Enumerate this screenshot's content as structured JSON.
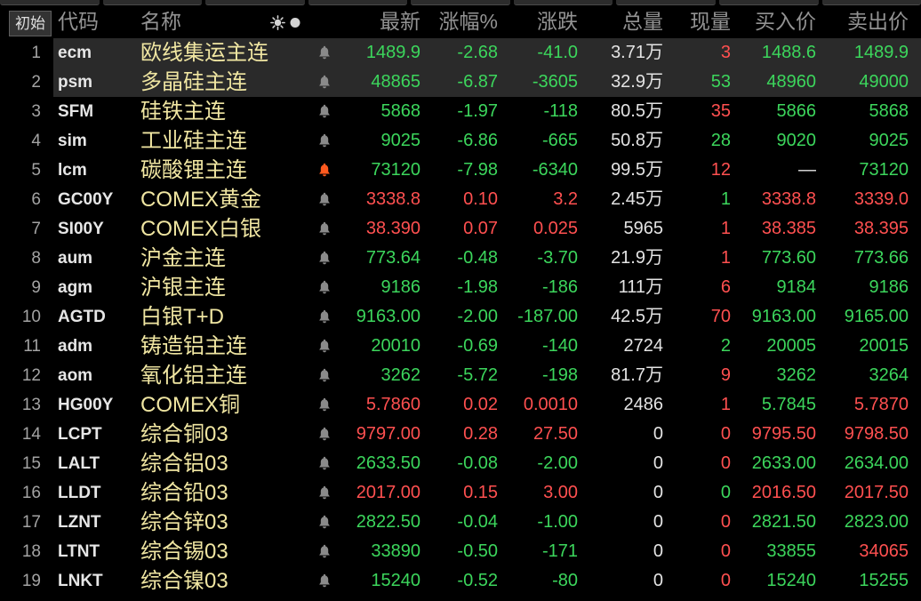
{
  "colors": {
    "background": "#000000",
    "selected_row": "#2a2a2a",
    "red": "#ff5050",
    "green": "#3cd65c",
    "white": "#e4e4e4",
    "name_text": "#f0e6a2",
    "code_text": "#e6e6e6",
    "header_text": "#939393",
    "index_text": "#a3a3a3",
    "header_icon": "#d4d4d4",
    "bell_idle": "#8a8a8a",
    "bell_active": "#ff5a1f"
  },
  "toolbar": {
    "reset_label": "初始"
  },
  "columns": {
    "code": "代码",
    "name": "名称",
    "last": "最新",
    "pct": "涨幅%",
    "chg": "涨跌",
    "vol": "总量",
    "cur": "现量",
    "bid": "买入价",
    "ask": "卖出价"
  },
  "header_icons": [
    "sun-icon",
    "dot-icon"
  ],
  "row_icon": "bell-icon",
  "rows": [
    {
      "no": "1",
      "code": "ecm",
      "name": "欧线集运主连",
      "selected": true,
      "alert": false,
      "values": [
        "1489.9",
        "-2.68",
        "-41.0",
        "3.71万",
        "3",
        "1488.6",
        "1489.9"
      ],
      "tones": [
        "green",
        "green",
        "green",
        "white",
        "red",
        "green",
        "green"
      ]
    },
    {
      "no": "2",
      "code": "psm",
      "name": "多晶硅主连",
      "selected": true,
      "alert": false,
      "values": [
        "48865",
        "-6.87",
        "-3605",
        "32.9万",
        "53",
        "48960",
        "49000"
      ],
      "tones": [
        "green",
        "green",
        "green",
        "white",
        "green",
        "green",
        "green"
      ]
    },
    {
      "no": "3",
      "code": "SFM",
      "name": "硅铁主连",
      "selected": false,
      "alert": false,
      "values": [
        "5868",
        "-1.97",
        "-118",
        "80.5万",
        "35",
        "5866",
        "5868"
      ],
      "tones": [
        "green",
        "green",
        "green",
        "white",
        "red",
        "green",
        "green"
      ]
    },
    {
      "no": "4",
      "code": "sim",
      "name": "工业硅主连",
      "selected": false,
      "alert": false,
      "values": [
        "9025",
        "-6.86",
        "-665",
        "50.8万",
        "28",
        "9020",
        "9025"
      ],
      "tones": [
        "green",
        "green",
        "green",
        "white",
        "green",
        "green",
        "green"
      ]
    },
    {
      "no": "5",
      "code": "lcm",
      "name": "碳酸锂主连",
      "selected": false,
      "alert": true,
      "values": [
        "73120",
        "-7.98",
        "-6340",
        "99.5万",
        "12",
        "—",
        "73120"
      ],
      "tones": [
        "green",
        "green",
        "green",
        "white",
        "red",
        "white",
        "green"
      ]
    },
    {
      "no": "6",
      "code": "GC00Y",
      "name": "COMEX黄金",
      "selected": false,
      "alert": false,
      "values": [
        "3338.8",
        "0.10",
        "3.2",
        "2.45万",
        "1",
        "3338.8",
        "3339.0"
      ],
      "tones": [
        "red",
        "red",
        "red",
        "white",
        "green",
        "red",
        "red"
      ]
    },
    {
      "no": "7",
      "code": "SI00Y",
      "name": "COMEX白银",
      "selected": false,
      "alert": false,
      "values": [
        "38.390",
        "0.07",
        "0.025",
        "5965",
        "1",
        "38.385",
        "38.395"
      ],
      "tones": [
        "red",
        "red",
        "red",
        "white",
        "red",
        "red",
        "red"
      ]
    },
    {
      "no": "8",
      "code": "aum",
      "name": "沪金主连",
      "selected": false,
      "alert": false,
      "values": [
        "773.64",
        "-0.48",
        "-3.70",
        "21.9万",
        "1",
        "773.60",
        "773.66"
      ],
      "tones": [
        "green",
        "green",
        "green",
        "white",
        "red",
        "green",
        "green"
      ]
    },
    {
      "no": "9",
      "code": "agm",
      "name": "沪银主连",
      "selected": false,
      "alert": false,
      "values": [
        "9186",
        "-1.98",
        "-186",
        "111万",
        "6",
        "9184",
        "9186"
      ],
      "tones": [
        "green",
        "green",
        "green",
        "white",
        "red",
        "green",
        "green"
      ]
    },
    {
      "no": "10",
      "code": "AGTD",
      "name": "白银T+D",
      "selected": false,
      "alert": false,
      "values": [
        "9163.00",
        "-2.00",
        "-187.00",
        "42.5万",
        "70",
        "9163.00",
        "9165.00"
      ],
      "tones": [
        "green",
        "green",
        "green",
        "white",
        "red",
        "green",
        "green"
      ]
    },
    {
      "no": "11",
      "code": "adm",
      "name": "铸造铝主连",
      "selected": false,
      "alert": false,
      "values": [
        "20010",
        "-0.69",
        "-140",
        "2724",
        "2",
        "20005",
        "20015"
      ],
      "tones": [
        "green",
        "green",
        "green",
        "white",
        "green",
        "green",
        "green"
      ]
    },
    {
      "no": "12",
      "code": "aom",
      "name": "氧化铝主连",
      "selected": false,
      "alert": false,
      "values": [
        "3262",
        "-5.72",
        "-198",
        "81.7万",
        "9",
        "3262",
        "3264"
      ],
      "tones": [
        "green",
        "green",
        "green",
        "white",
        "red",
        "green",
        "green"
      ]
    },
    {
      "no": "13",
      "code": "HG00Y",
      "name": "COMEX铜",
      "selected": false,
      "alert": false,
      "values": [
        "5.7860",
        "0.02",
        "0.0010",
        "2486",
        "1",
        "5.7845",
        "5.7870"
      ],
      "tones": [
        "red",
        "red",
        "red",
        "white",
        "red",
        "green",
        "red"
      ]
    },
    {
      "no": "14",
      "code": "LCPT",
      "name": "综合铜03",
      "selected": false,
      "alert": false,
      "values": [
        "9797.00",
        "0.28",
        "27.50",
        "0",
        "0",
        "9795.50",
        "9798.50"
      ],
      "tones": [
        "red",
        "red",
        "red",
        "white",
        "red",
        "red",
        "red"
      ]
    },
    {
      "no": "15",
      "code": "LALT",
      "name": "综合铝03",
      "selected": false,
      "alert": false,
      "values": [
        "2633.50",
        "-0.08",
        "-2.00",
        "0",
        "0",
        "2633.00",
        "2634.00"
      ],
      "tones": [
        "green",
        "green",
        "green",
        "white",
        "red",
        "green",
        "green"
      ]
    },
    {
      "no": "16",
      "code": "LLDT",
      "name": "综合铅03",
      "selected": false,
      "alert": false,
      "values": [
        "2017.00",
        "0.15",
        "3.00",
        "0",
        "0",
        "2016.50",
        "2017.50"
      ],
      "tones": [
        "red",
        "red",
        "red",
        "white",
        "green",
        "red",
        "red"
      ]
    },
    {
      "no": "17",
      "code": "LZNT",
      "name": "综合锌03",
      "selected": false,
      "alert": false,
      "values": [
        "2822.50",
        "-0.04",
        "-1.00",
        "0",
        "0",
        "2821.50",
        "2823.00"
      ],
      "tones": [
        "green",
        "green",
        "green",
        "white",
        "red",
        "green",
        "green"
      ]
    },
    {
      "no": "18",
      "code": "LTNT",
      "name": "综合锡03",
      "selected": false,
      "alert": false,
      "values": [
        "33890",
        "-0.50",
        "-171",
        "0",
        "0",
        "33855",
        "34065"
      ],
      "tones": [
        "green",
        "green",
        "green",
        "white",
        "red",
        "green",
        "red"
      ]
    },
    {
      "no": "19",
      "code": "LNKT",
      "name": "综合镍03",
      "selected": false,
      "alert": false,
      "values": [
        "15240",
        "-0.52",
        "-80",
        "0",
        "0",
        "15240",
        "15255"
      ],
      "tones": [
        "green",
        "green",
        "green",
        "white",
        "red",
        "green",
        "green"
      ]
    }
  ]
}
